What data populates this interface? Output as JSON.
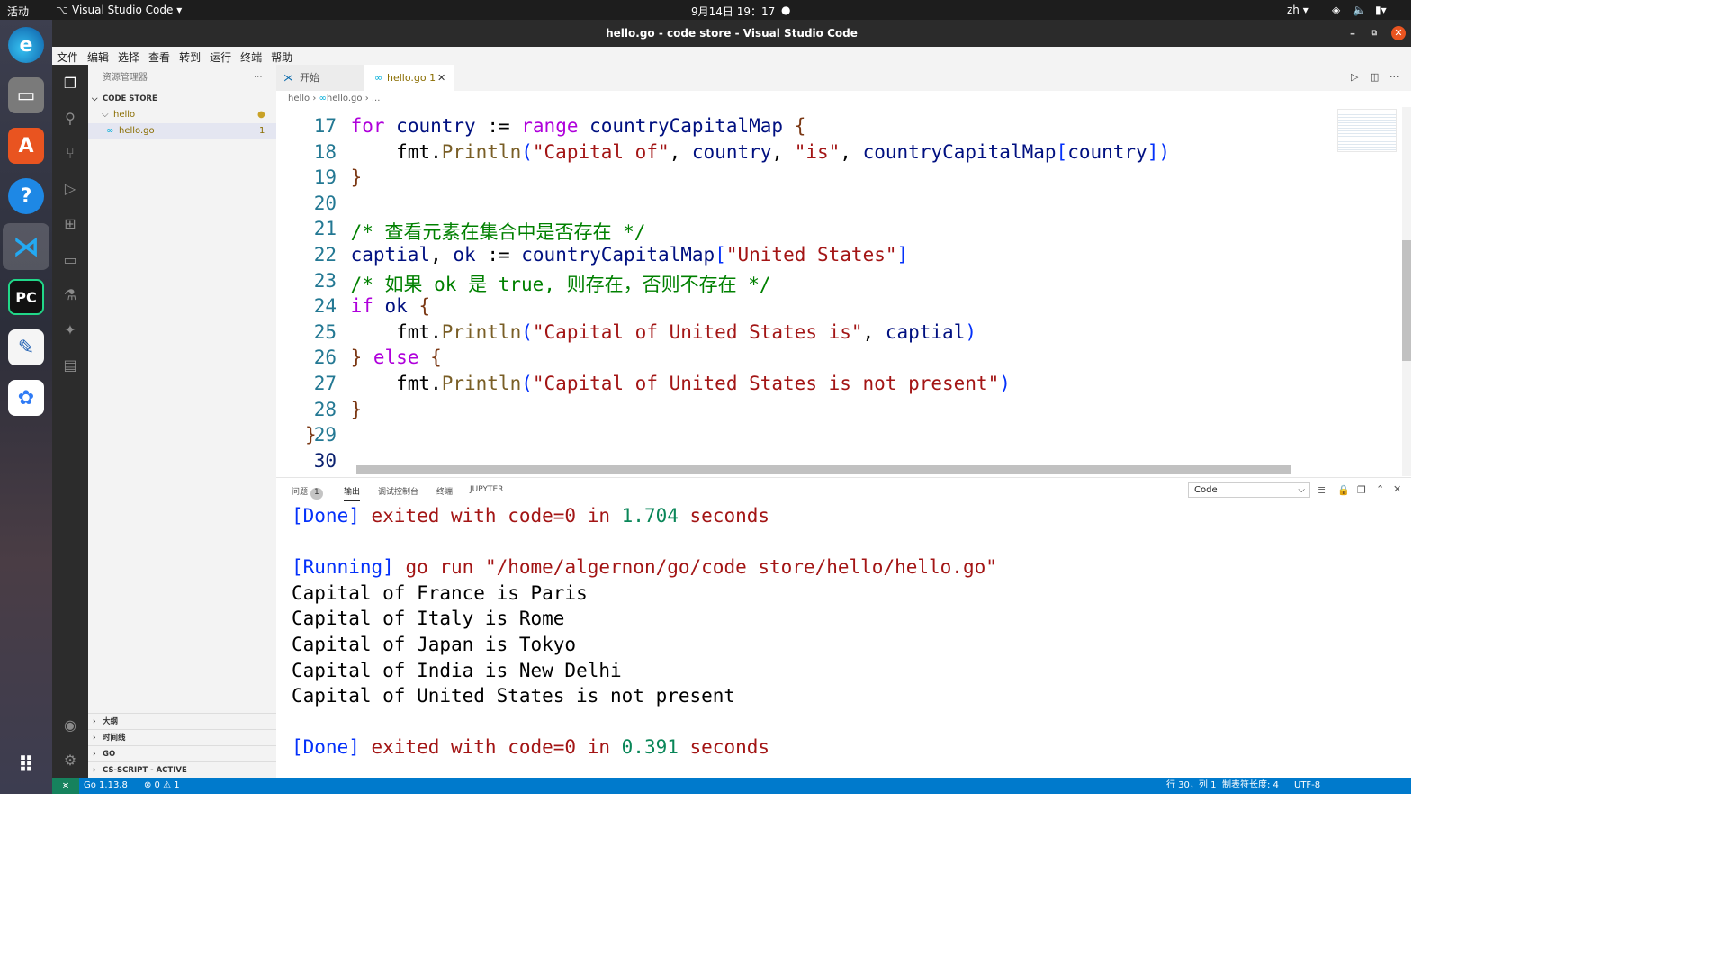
{
  "topbar": {
    "activities": "活动",
    "app": "Visual Studio Code ▾",
    "clock": "9月14日 19：17",
    "lang": "zh ▾"
  },
  "window": {
    "title": "hello.go - code store - Visual Studio Code"
  },
  "menu": [
    "文件",
    "编辑",
    "选择",
    "查看",
    "转到",
    "运行",
    "终端",
    "帮助"
  ],
  "sidebar": {
    "title": "资源管理器",
    "root": "CODE STORE",
    "folder": "hello",
    "file": "hello.go",
    "file_badge": "1",
    "sections": [
      "大纲",
      "时间线",
      "GO",
      "CS-SCRIPT - ACTIVE"
    ]
  },
  "tabs": [
    {
      "label": "开始"
    },
    {
      "label": "hello.go",
      "badge": "1"
    }
  ],
  "breadcrumb": {
    "folder": "hello",
    "file": "hello.go",
    "more": "..."
  },
  "editor": {
    "lines": [
      {
        "n": "17",
        "code": "    for country := range countryCapitalMap {"
      },
      {
        "n": "18",
        "code": "        fmt.Println(\"Capital of\", country, \"is\", countryCapitalMap[country])"
      },
      {
        "n": "19",
        "code": "    }"
      },
      {
        "n": "20",
        "code": ""
      },
      {
        "n": "21",
        "code": "    /* 查看元素在集合中是否存在 */"
      },
      {
        "n": "22",
        "code": "    captial, ok := countryCapitalMap[\"United States\"]"
      },
      {
        "n": "23",
        "code": "    /* 如果 ok 是 true, 则存在，否则不存在 */"
      },
      {
        "n": "24",
        "code": "    if ok {"
      },
      {
        "n": "25",
        "code": "        fmt.Println(\"Capital of United States is\", captial)"
      },
      {
        "n": "26",
        "code": "    } else {"
      },
      {
        "n": "27",
        "code": "        fmt.Println(\"Capital of United States is not present\")"
      },
      {
        "n": "28",
        "code": "    }"
      },
      {
        "n": "29",
        "code": "}"
      },
      {
        "n": "30",
        "code": ""
      }
    ]
  },
  "panel": {
    "tabs": [
      "问题",
      "输出",
      "调试控制台",
      "终端",
      "JUPYTER"
    ],
    "problems_count": "1",
    "channel": "Code",
    "output": [
      "[Done] exited with code=0 in 1.704 seconds",
      "",
      "[Running] go run \"/home/algernon/go/code store/hello/hello.go\"",
      "Capital of France is Paris",
      "Capital of Italy is Rome",
      "Capital of Japan is Tokyo",
      "Capital of India is New Delhi",
      "Capital of United States is not present",
      "",
      "[Done] exited with code=0 in 0.391 seconds"
    ]
  },
  "status": {
    "go": "Go 1.13.8",
    "problems": "⊗ 0 ⚠ 1",
    "position": "行 30，列 1",
    "spaces": "制表符长度: 4",
    "encoding": "UTF-8"
  },
  "colors": {
    "accent": "#007acc",
    "keyword": "#0000ff",
    "string": "#a31515",
    "comment": "#008000"
  }
}
